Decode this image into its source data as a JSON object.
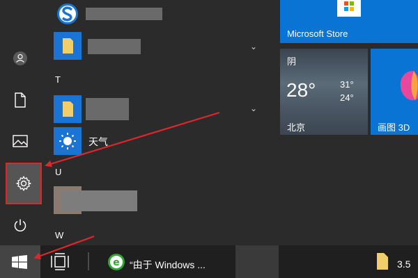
{
  "tiles": {
    "store_label": "Microsoft Store",
    "weather": {
      "condition": "阴",
      "temp": "28°",
      "high": "31°",
      "low": "24°",
      "city": "北京"
    },
    "paint3d_label": "画图 3D"
  },
  "applist": {
    "letter_t": "T",
    "letter_u": "U",
    "letter_w": "W",
    "weather_app": "天气"
  },
  "taskbar": {
    "ie_title": "“由于 Windows ...",
    "file_label": "3.5"
  },
  "colors": {
    "accent": "#0a74d4",
    "highlight_border": "#e0262b",
    "arrow": "#e0262b"
  }
}
